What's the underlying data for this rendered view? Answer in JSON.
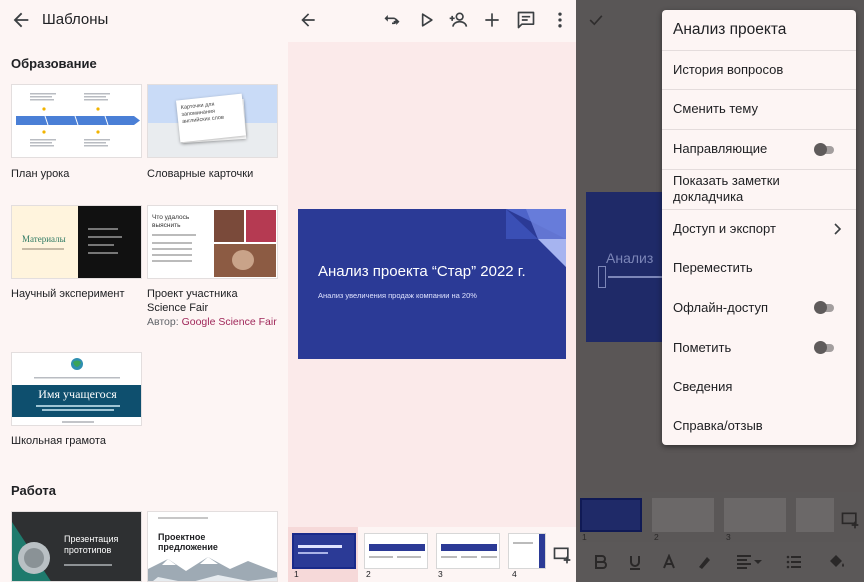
{
  "templates_panel": {
    "title": "Шаблоны",
    "section_education": "Образование",
    "section_work": "Работа",
    "templates": [
      {
        "name": "План урока"
      },
      {
        "name": "Словарные карточки",
        "thumb_text": "Карточки для запоминания английских слов"
      },
      {
        "name": "Научный эксперимент",
        "thumb_text": "Материалы"
      },
      {
        "name": "Проект участника Science Fair",
        "author_label": "Автор:",
        "author": "Google Science Fair",
        "thumb_text": "Что удалось выяснить"
      },
      {
        "name": "Школьная грамота",
        "thumb_text": "Имя учащегося"
      },
      {
        "thumb_text": "Презентация прототипов"
      },
      {
        "thumb_text": "Проектное предложение"
      }
    ]
  },
  "editor": {
    "slide_title": "Анализ проекта “Стар” 2022 г.",
    "slide_subtitle": "Анализ увеличения продаж компании на 20%",
    "thumb_numbers": [
      "1",
      "2",
      "3",
      "4"
    ]
  },
  "menu": {
    "header": "Анализ проекта",
    "items": [
      {
        "label": "История вопросов"
      },
      {
        "label": "Сменить тему"
      },
      {
        "label": "Направляющие",
        "toggle": false
      },
      {
        "label": "Показать заметки докладчика"
      },
      {
        "label": "Доступ и экспорт",
        "submenu": true
      },
      {
        "label": "Переместить"
      },
      {
        "label": "Офлайн-доступ",
        "toggle": false
      },
      {
        "label": "Пометить",
        "toggle": false
      },
      {
        "label": "Сведения"
      },
      {
        "label": "Справка/отзыв"
      }
    ]
  },
  "background_editor": {
    "slide_title_fragment": "Анализ",
    "thumb_numbers": [
      "1",
      "2",
      "3"
    ]
  },
  "colors": {
    "accent_blue": "#2b3a96",
    "panel_bg": "#fdf5f4",
    "author_link": "#a0285a"
  }
}
